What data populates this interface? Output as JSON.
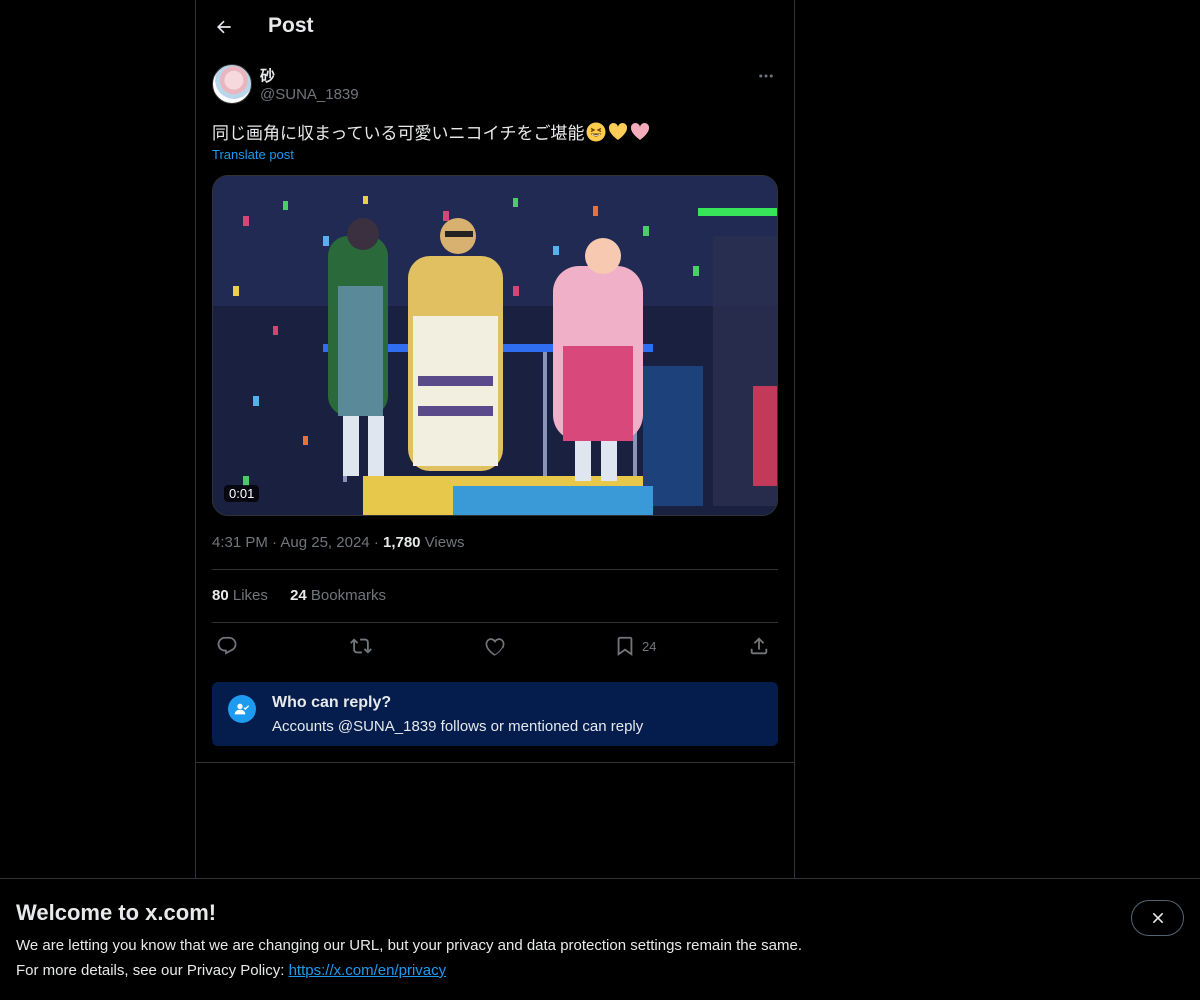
{
  "header": {
    "title": "Post",
    "back_icon": "arrow-left-icon"
  },
  "author": {
    "name": "砂",
    "handle": "@SUNA_1839",
    "more_icon": "more-horizontal-icon"
  },
  "post": {
    "text": "同じ画角に収まっている可愛いニコイチをご堪能",
    "emojis": [
      "grinning-squinting-face-emoji",
      "yellow-heart-emoji",
      "pink-heart-emoji"
    ],
    "translate_label": "Translate post"
  },
  "media": {
    "duration": "0:01"
  },
  "meta": {
    "time": "4:31 PM",
    "sep1": "·",
    "date": "Aug 25, 2024",
    "sep2": "·",
    "views_count": "1,780",
    "views_label": "Views"
  },
  "stats": {
    "likes_count": "80",
    "likes_label": "Likes",
    "bookmarks_count": "24",
    "bookmarks_label": "Bookmarks"
  },
  "actions": {
    "reply_icon": "reply-icon",
    "repost_icon": "repost-icon",
    "like_icon": "heart-icon",
    "bookmark_icon": "bookmark-icon",
    "bookmark_count": "24",
    "share_icon": "share-icon"
  },
  "reply_restriction": {
    "title": "Who can reply?",
    "subtitle": "Accounts @SUNA_1839 follows or mentioned can reply",
    "icon": "user-check-icon"
  },
  "banner": {
    "title": "Welcome to x.com!",
    "line1": "We are letting you know that we are changing our URL, but your privacy and data protection settings remain the same.",
    "line2_prefix": "For more details, see our Privacy Policy: ",
    "link": "https://x.com/en/privacy",
    "close_icon": "close-icon"
  },
  "colors": {
    "background": "#000000",
    "text": "#e7e9ea",
    "muted": "#71767b",
    "accent": "#1d9bf0",
    "divider": "#2f3336",
    "reply_box": "#051d4d"
  }
}
